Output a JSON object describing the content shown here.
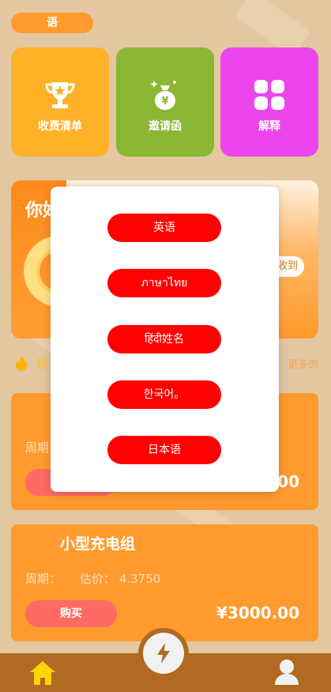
{
  "top": {
    "language_label": "语"
  },
  "tiles": [
    {
      "label": "收费清单",
      "color": "#ffb128",
      "icon": "trophy-icon"
    },
    {
      "label": "邀请函",
      "color": "#8bb833",
      "icon": "money-bag-icon"
    },
    {
      "label": "解释",
      "color": "#ec45ee",
      "icon": "grid-icon"
    }
  ],
  "banner": {
    "title": "你好",
    "receive_label": "收到"
  },
  "news": {
    "lead": "热",
    "tail": "更多的"
  },
  "cards": [
    {
      "name": "",
      "period_label": "周期：",
      "estimate_label": "",
      "estimate_value": "",
      "buy_label": "",
      "price": "00"
    },
    {
      "name": "小型充电组",
      "period_label": "周期：",
      "estimate_label": "估价：",
      "estimate_value": "4.3750",
      "buy_label": "购买",
      "price": "¥3000.00"
    }
  ],
  "language_modal": {
    "options": [
      "英语",
      "ภาษาไทย",
      "हिंदी姓名",
      "한국어。",
      "日本语"
    ]
  },
  "tabbar": {
    "home_icon": "home-icon",
    "center_icon": "lightning-icon",
    "user_icon": "user-icon"
  },
  "colors": {
    "background": "#e2c7a1",
    "accent_orange": "#ff9a2f",
    "modal_button_red": "#ff0000",
    "buy_button": "#ff6a63",
    "tabbar": "#b06a21"
  }
}
